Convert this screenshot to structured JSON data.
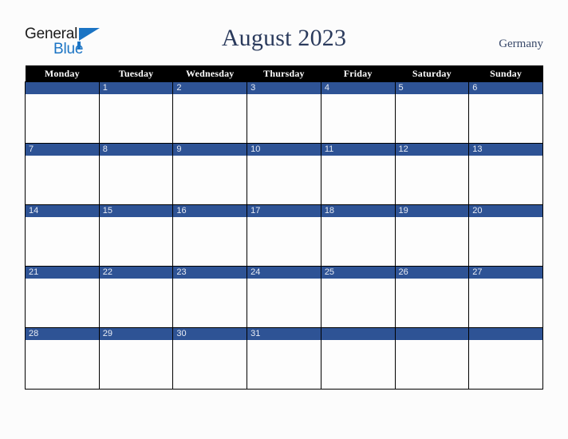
{
  "brand": {
    "name_part1": "General",
    "name_part2": "Blue",
    "colors": {
      "blue": "#1b74c4",
      "dark": "#1c1c1c"
    }
  },
  "header": {
    "title": "August 2023",
    "country": "Germany",
    "title_color": "#2a3a5c",
    "country_color": "#3a4a6b"
  },
  "calendar": {
    "month": "August",
    "year": "2023",
    "weekday_headers": [
      "Monday",
      "Tuesday",
      "Wednesday",
      "Thursday",
      "Friday",
      "Saturday",
      "Sunday"
    ],
    "colors": {
      "header_bg": "#000000",
      "header_text": "#ffffff",
      "day_banner_bg": "#2e5395",
      "day_number_text": "#e8ecf5",
      "cell_bg": "#fdfdfd",
      "grid_line": "#000000",
      "page_bg": "#fcfcfc"
    },
    "weeks": [
      [
        {
          "day": ""
        },
        {
          "day": "1"
        },
        {
          "day": "2"
        },
        {
          "day": "3"
        },
        {
          "day": "4"
        },
        {
          "day": "5"
        },
        {
          "day": "6"
        }
      ],
      [
        {
          "day": "7"
        },
        {
          "day": "8"
        },
        {
          "day": "9"
        },
        {
          "day": "10"
        },
        {
          "day": "11"
        },
        {
          "day": "12"
        },
        {
          "day": "13"
        }
      ],
      [
        {
          "day": "14"
        },
        {
          "day": "15"
        },
        {
          "day": "16"
        },
        {
          "day": "17"
        },
        {
          "day": "18"
        },
        {
          "day": "19"
        },
        {
          "day": "20"
        }
      ],
      [
        {
          "day": "21"
        },
        {
          "day": "22"
        },
        {
          "day": "23"
        },
        {
          "day": "24"
        },
        {
          "day": "25"
        },
        {
          "day": "26"
        },
        {
          "day": "27"
        }
      ],
      [
        {
          "day": "28"
        },
        {
          "day": "29"
        },
        {
          "day": "30"
        },
        {
          "day": "31"
        },
        {
          "day": ""
        },
        {
          "day": ""
        },
        {
          "day": ""
        }
      ]
    ]
  }
}
